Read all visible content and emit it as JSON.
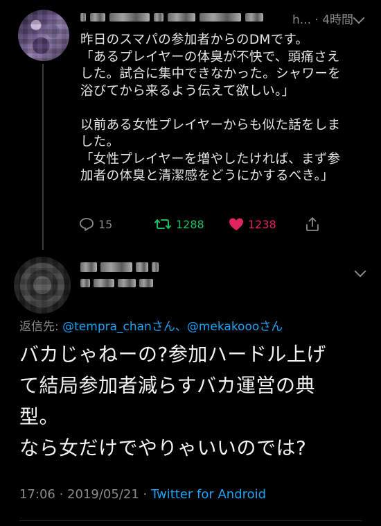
{
  "tweet1": {
    "handle_time": "h... · 4時間",
    "body_lines": [
      "昨日のスマパの参加者からのDMです。",
      "「あるプレイヤーの体臭が不快で、頭痛さえ",
      "した。試合に集中できなかった。シャワーを",
      "浴びてから来るよう伝えて欲しい。」",
      "",
      "以前ある女性プレイヤーからも似た話をしま",
      "した。",
      "「女性プレイヤーを増やしたければ、まず参",
      "加者の体臭と清潔感をどうにかするべき。」"
    ],
    "reply_count": "15",
    "retweet_count": "1288",
    "like_count": "1238"
  },
  "tweet2": {
    "reply_to_label": "返信先: ",
    "reply_to_handles": "@tempra_chanさん、@mekakoooさん",
    "text_lines": [
      "バカじゃねーの?参加ハードル上げ",
      "て結局参加者減らすバカ運営の典",
      "型。",
      "なら女だけでやりゃいいのでは?"
    ],
    "timestamp": "17:06 · 2019/05/21 · ",
    "source": "Twitter for Android"
  },
  "colors": {
    "background": "#000000",
    "link": "#1da1f2",
    "retweet": "#17bf63",
    "like": "#e0245e",
    "muted": "#8a8a8a"
  }
}
